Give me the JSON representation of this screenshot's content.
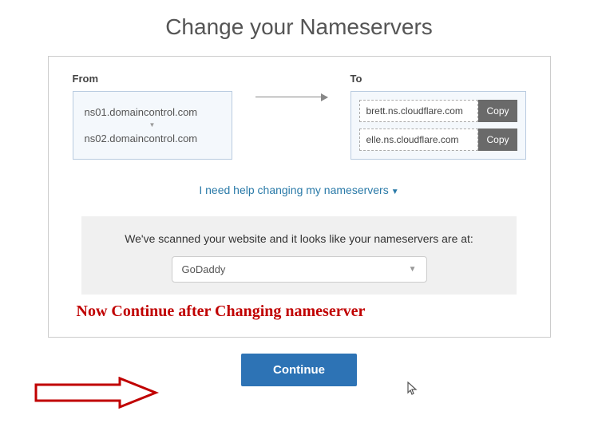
{
  "title": "Change your Nameservers",
  "from": {
    "label": "From",
    "ns1": "ns01.domaincontrol.com",
    "ns2": "ns02.domaincontrol.com"
  },
  "to": {
    "label": "To",
    "ns1": "brett.ns.cloudflare.com",
    "ns2": "elle.ns.cloudflare.com",
    "copy_label": "Copy"
  },
  "help_link": "I need help changing my nameservers",
  "scan": {
    "text": "We've scanned your website and it looks like your nameservers are at:",
    "registrar": "GoDaddy"
  },
  "annotation": "Now Continue after Changing nameserver",
  "continue_label": "Continue"
}
